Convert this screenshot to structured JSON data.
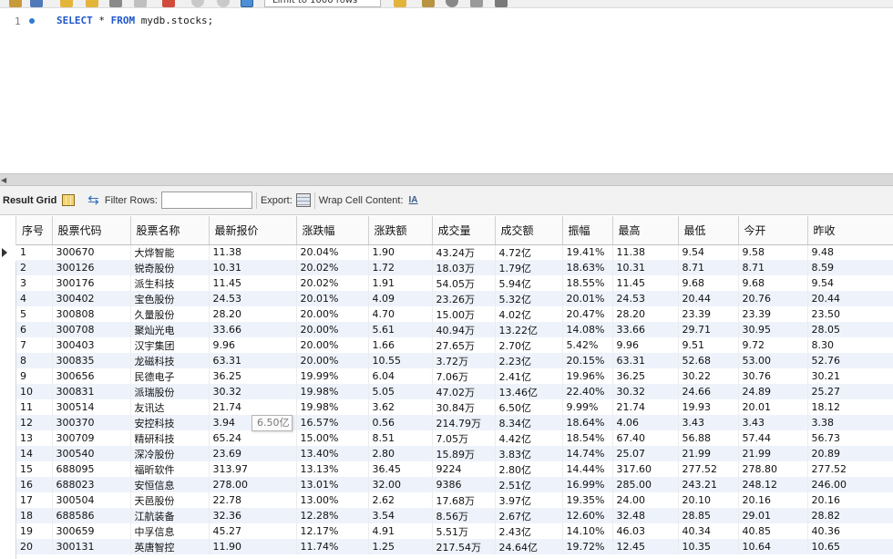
{
  "toolbar": {
    "limit_select_value": "Limit to 1000 rows"
  },
  "editor": {
    "line_number": "1",
    "sql_select": "SELECT",
    "sql_star": " * ",
    "sql_from": "FROM",
    "sql_rest": " mydb.stocks;"
  },
  "result_toolbar": {
    "result_grid_label": "Result Grid",
    "filter_rows_label": "Filter Rows:",
    "filter_value": "",
    "export_label": "Export:",
    "wrap_label": "Wrap Cell Content:",
    "wrap_icon_text": "IA"
  },
  "table": {
    "columns": [
      "序号",
      "股票代码",
      "股票名称",
      "最新报价",
      "涨跌幅",
      "涨跌额",
      "成交量",
      "成交额",
      "振幅",
      "最高",
      "最低",
      "今开",
      "昨收"
    ],
    "rows": [
      [
        "1",
        "300670",
        "大烨智能",
        "11.38",
        "20.04%",
        "1.90",
        "43.24万",
        "4.72亿",
        "19.41%",
        "11.38",
        "9.54",
        "9.58",
        "9.48"
      ],
      [
        "2",
        "300126",
        "锐奇股份",
        "10.31",
        "20.02%",
        "1.72",
        "18.03万",
        "1.79亿",
        "18.63%",
        "10.31",
        "8.71",
        "8.71",
        "8.59"
      ],
      [
        "3",
        "300176",
        "派生科技",
        "11.45",
        "20.02%",
        "1.91",
        "54.05万",
        "5.94亿",
        "18.55%",
        "11.45",
        "9.68",
        "9.68",
        "9.54"
      ],
      [
        "4",
        "300402",
        "宝色股份",
        "24.53",
        "20.01%",
        "4.09",
        "23.26万",
        "5.32亿",
        "20.01%",
        "24.53",
        "20.44",
        "20.76",
        "20.44"
      ],
      [
        "5",
        "300808",
        "久量股份",
        "28.20",
        "20.00%",
        "4.70",
        "15.00万",
        "4.02亿",
        "20.47%",
        "28.20",
        "23.39",
        "23.39",
        "23.50"
      ],
      [
        "6",
        "300708",
        "聚灿光电",
        "33.66",
        "20.00%",
        "5.61",
        "40.94万",
        "13.22亿",
        "14.08%",
        "33.66",
        "29.71",
        "30.95",
        "28.05"
      ],
      [
        "7",
        "300403",
        "汉宇集团",
        "9.96",
        "20.00%",
        "1.66",
        "27.65万",
        "2.70亿",
        "5.42%",
        "9.96",
        "9.51",
        "9.72",
        "8.30"
      ],
      [
        "8",
        "300835",
        "龙磁科技",
        "63.31",
        "20.00%",
        "10.55",
        "3.72万",
        "2.23亿",
        "20.15%",
        "63.31",
        "52.68",
        "53.00",
        "52.76"
      ],
      [
        "9",
        "300656",
        "民德电子",
        "36.25",
        "19.99%",
        "6.04",
        "7.06万",
        "2.41亿",
        "19.96%",
        "36.25",
        "30.22",
        "30.76",
        "30.21"
      ],
      [
        "10",
        "300831",
        "派瑞股份",
        "30.32",
        "19.98%",
        "5.05",
        "47.02万",
        "13.46亿",
        "22.40%",
        "30.32",
        "24.66",
        "24.89",
        "25.27"
      ],
      [
        "11",
        "300514",
        "友讯达",
        "21.74",
        "19.98%",
        "3.62",
        "30.84万",
        "6.50亿",
        "9.99%",
        "21.74",
        "19.93",
        "20.01",
        "18.12"
      ],
      [
        "12",
        "300370",
        "安控科技",
        "3.94",
        "16.57%",
        "0.56",
        "214.79万",
        "8.34亿",
        "18.64%",
        "4.06",
        "3.43",
        "3.43",
        "3.38"
      ],
      [
        "13",
        "300709",
        "精研科技",
        "65.24",
        "15.00%",
        "8.51",
        "7.05万",
        "4.42亿",
        "18.54%",
        "67.40",
        "56.88",
        "57.44",
        "56.73"
      ],
      [
        "14",
        "300540",
        "深冷股份",
        "23.69",
        "13.40%",
        "2.80",
        "15.89万",
        "3.83亿",
        "14.74%",
        "25.07",
        "21.99",
        "21.99",
        "20.89"
      ],
      [
        "15",
        "688095",
        "福昕软件",
        "313.97",
        "13.13%",
        "36.45",
        "9224",
        "2.80亿",
        "14.44%",
        "317.60",
        "277.52",
        "278.80",
        "277.52"
      ],
      [
        "16",
        "688023",
        "安恒信息",
        "278.00",
        "13.01%",
        "32.00",
        "9386",
        "2.51亿",
        "16.99%",
        "285.00",
        "243.21",
        "248.12",
        "246.00"
      ],
      [
        "17",
        "300504",
        "天邑股份",
        "22.78",
        "13.00%",
        "2.62",
        "17.68万",
        "3.97亿",
        "19.35%",
        "24.00",
        "20.10",
        "20.16",
        "20.16"
      ],
      [
        "18",
        "688586",
        "江航装备",
        "32.36",
        "12.28%",
        "3.54",
        "8.56万",
        "2.67亿",
        "12.60%",
        "32.48",
        "28.85",
        "29.01",
        "28.82"
      ],
      [
        "19",
        "300659",
        "中孚信息",
        "45.27",
        "12.17%",
        "4.91",
        "5.51万",
        "2.43亿",
        "14.10%",
        "46.03",
        "40.34",
        "40.85",
        "40.36"
      ],
      [
        "20",
        "300131",
        "英唐智控",
        "11.90",
        "11.74%",
        "1.25",
        "217.54万",
        "24.64亿",
        "19.72%",
        "12.45",
        "10.35",
        "10.64",
        "10.65"
      ]
    ]
  },
  "tooltip": {
    "text": "6.50亿"
  }
}
